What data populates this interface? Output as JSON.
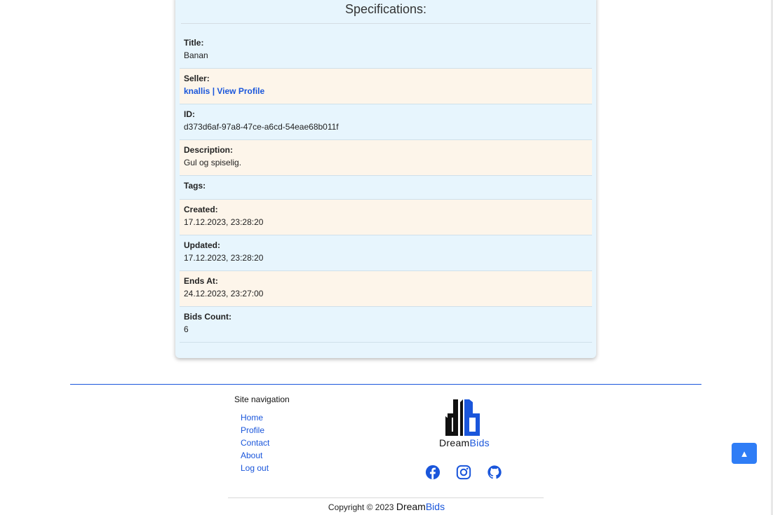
{
  "specs": {
    "heading": "Specifications:",
    "rows": [
      {
        "label": "Title:",
        "value": "Banan"
      },
      {
        "label": "Seller:",
        "value": "knallis | View Profile"
      },
      {
        "label": "ID:",
        "value": "d373d6af-97a8-47ce-a6cd-54eae68b011f"
      },
      {
        "label": "Description:",
        "value": "Gul og spiselig."
      },
      {
        "label": "Tags:",
        "value": ""
      },
      {
        "label": "Created:",
        "value": "17.12.2023, 23:28:20"
      },
      {
        "label": "Updated:",
        "value": "17.12.2023, 23:28:20"
      },
      {
        "label": "Ends At:",
        "value": "24.12.2023, 23:27:00"
      },
      {
        "label": "Bids Count:",
        "value": "6"
      }
    ]
  },
  "footer": {
    "nav_title": "Site navigation",
    "nav_links": [
      "Home",
      "Profile",
      "Contact",
      "About",
      "Log out"
    ],
    "brand": {
      "dream": "Dream",
      "bids": "Bids"
    },
    "socials": [
      "facebook-icon",
      "instagram-icon",
      "github-icon"
    ],
    "copyright": "Copyright © 2023"
  },
  "scroll_top": {
    "icon": "▲"
  },
  "colors": {
    "accent": "#1a56db",
    "card": "#e7f5fd",
    "row_alt": "#fdf5ea",
    "button": "#2f7df6"
  }
}
